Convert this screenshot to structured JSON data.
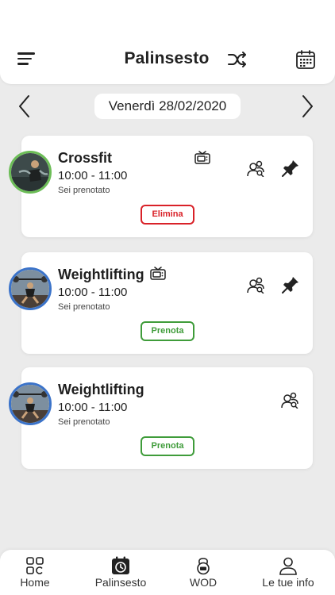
{
  "header": {
    "title": "Palinsesto",
    "menu_icon": "menu-icon",
    "shuffle_icon": "shuffle-icon",
    "calendar_icon": "calendar-icon"
  },
  "date_nav": {
    "date": "Venerdì 28/02/2020",
    "prev_icon": "chevron-left-icon",
    "next_icon": "chevron-right-icon"
  },
  "classes": [
    {
      "name": "Crossfit",
      "time": "10:00 - 11:00",
      "status": "Sei prenotato",
      "action_label": "Elimina",
      "action_color": "#d92128",
      "avatar_border": "#6cbd57",
      "has_tv_icon": true,
      "has_pin_icon": true
    },
    {
      "name": "Weightlifting",
      "time": "10:00 - 11:00",
      "status": "Sei prenotato",
      "action_label": "Prenota",
      "action_color": "#3f9c3a",
      "avatar_border": "#3b73c9",
      "has_tv_icon": true,
      "has_pin_icon": true
    },
    {
      "name": "Weightlifting",
      "time": "10:00 - 11:00",
      "status": "Sei prenotato",
      "action_label": "Prenota",
      "action_color": "#3f9c3a",
      "avatar_border": "#3b73c9",
      "has_tv_icon": false,
      "has_pin_icon": false
    }
  ],
  "bottom_nav": {
    "items": [
      {
        "label": "Home",
        "icon": "home-grid-icon"
      },
      {
        "label": "Palinsesto",
        "icon": "palinsesto-clock-icon",
        "active": true
      },
      {
        "label": "WOD",
        "icon": "kettlebell-icon"
      },
      {
        "label": "Le tue info",
        "icon": "user-icon"
      }
    ]
  },
  "colors": {
    "background": "#ebebeb",
    "card": "#ffffff",
    "delete_red": "#d92128",
    "book_green": "#3f9c3a"
  }
}
